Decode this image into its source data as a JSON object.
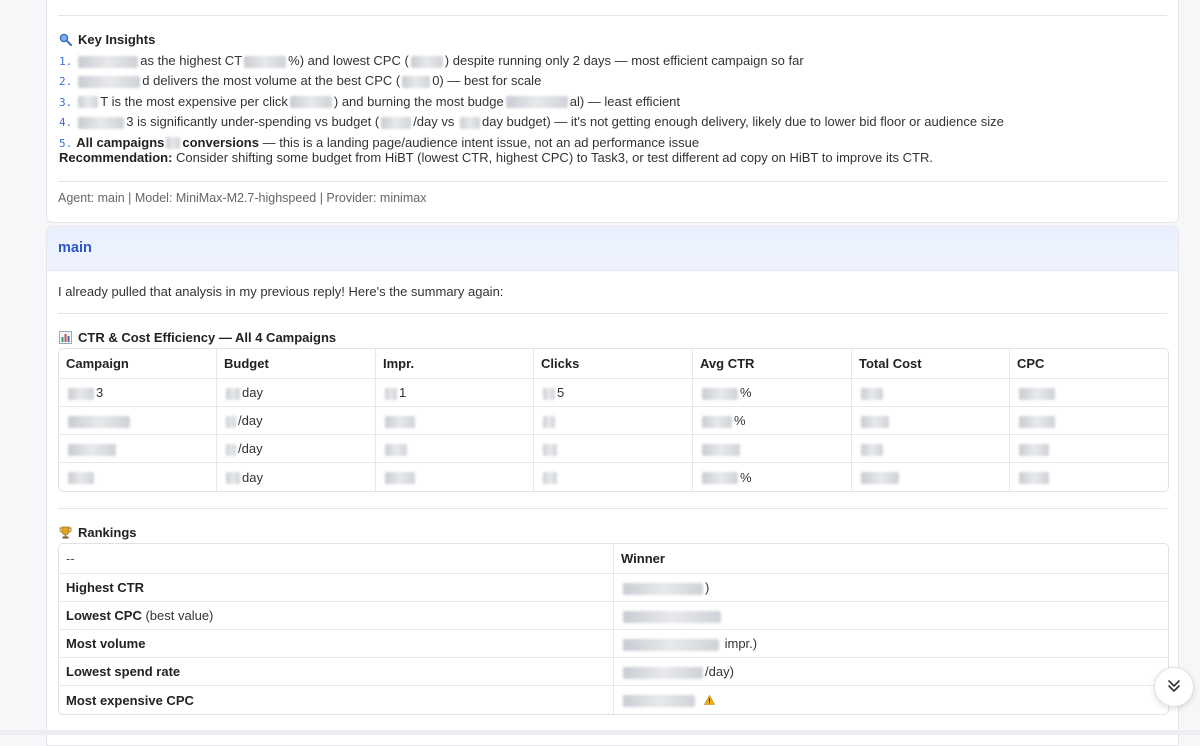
{
  "insights": {
    "title": "Key Insights",
    "icon": "magnifier-icon",
    "items": [
      {
        "num": "1.",
        "parts": [
          "as the highest CT",
          "%) and lowest CPC (",
          ") despite running only 2 days — most efficient campaign so far"
        ]
      },
      {
        "num": "2.",
        "parts": [
          "d delivers the most volume at the best CPC (",
          "0) — best for scale"
        ]
      },
      {
        "num": "3.",
        "parts": [
          "T is the most expensive per click",
          ") and burning the most budge",
          "al) — least efficient"
        ]
      },
      {
        "num": "4.",
        "parts": [
          "3 is significantly under-spending vs budget (",
          "/day vs ",
          "day budget) — it's not getting enough delivery, likely due to lower bid floor or audience size"
        ]
      },
      {
        "num": "5.",
        "bold_parts": [
          "All campaigns",
          "conversions"
        ],
        "rest": " — this is a landing page/audience intent issue, not an ad performance issue"
      }
    ],
    "recommendation_label": "Recommendation:",
    "recommendation_text": " Consider shifting some budget from HiBT (lowest CTR, highest CPC) to Task3, or test different ad copy on HiBT to improve its CTR."
  },
  "meta_line": "Agent: main | Model: MiniMax-M2.7-highspeed | Provider: minimax",
  "message": {
    "agent": "main",
    "intro": "I already pulled that analysis in my previous reply! Here's the summary again:"
  },
  "ctr_section": {
    "title": "CTR & Cost Efficiency — All 4 Campaigns",
    "icon": "bar-chart-icon",
    "headers": [
      "Campaign",
      "Budget",
      "Impr.",
      "Clicks",
      "Avg CTR",
      "Total Cost",
      "CPC"
    ],
    "rows": [
      {
        "campaign": "3",
        "budget": "day",
        "impr": "1",
        "clicks": "5",
        "ctr": "%",
        "cost": "",
        "cpc": ""
      },
      {
        "campaign": "",
        "budget": "/day",
        "impr": "",
        "clicks": "",
        "ctr": "%",
        "cost": "",
        "cpc": ""
      },
      {
        "campaign": "",
        "budget": "/day",
        "impr": "",
        "clicks": "",
        "ctr": "",
        "cost": "",
        "cpc": ""
      },
      {
        "campaign": "",
        "budget": "day",
        "impr": "",
        "clicks": "",
        "ctr": "%",
        "cost": "",
        "cpc": ""
      }
    ]
  },
  "rankings": {
    "title": "Rankings",
    "icon": "trophy-icon",
    "headers": [
      "--",
      "Winner"
    ],
    "rows": [
      {
        "label": "Highest CTR",
        "note": "",
        "winner": ")"
      },
      {
        "label": "Lowest CPC",
        "note": " (best value)",
        "winner": ""
      },
      {
        "label": "Most volume",
        "note": "",
        "winner": " impr.)"
      },
      {
        "label": "Lowest spend rate",
        "note": "",
        "winner": "/day)"
      },
      {
        "label": "Most expensive CPC",
        "note": "",
        "winner": "",
        "winner_icon": "warning-icon"
      }
    ]
  },
  "scroll_button": {
    "icon": "double-chevron-down-icon"
  }
}
